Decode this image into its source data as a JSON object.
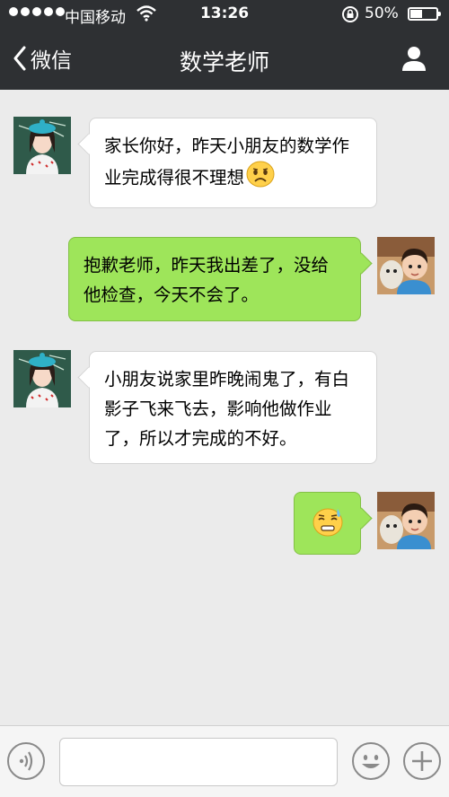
{
  "status_bar": {
    "carrier": "中国移动",
    "time": "13:26",
    "battery_percent_text": "50%",
    "battery_level": 0.5
  },
  "nav": {
    "back_label": "微信",
    "title": "数学老师"
  },
  "messages": [
    {
      "side": "incoming",
      "sender": "teacher",
      "text": "家长你好，昨天小朋友的数学作业完成得很不理想",
      "emoji": "frowning-face-emoji"
    },
    {
      "side": "outgoing",
      "sender": "parent",
      "text": "抱歉老师，昨天我出差了，没给他检查，今天不会了。"
    },
    {
      "side": "incoming",
      "sender": "teacher",
      "text": "小朋友说家里昨晚闹鬼了，有白影子飞来飞去，影响他做作业了，所以才完成的不好。"
    },
    {
      "side": "outgoing",
      "sender": "parent",
      "text": "",
      "emoji": "sweat-smile-emoji"
    }
  ],
  "input": {
    "placeholder": "",
    "value": ""
  },
  "colors": {
    "header_bg": "#2e3033",
    "chat_bg": "#ebebeb",
    "outgoing_bubble": "#9ee55a",
    "incoming_bubble": "#ffffff"
  }
}
